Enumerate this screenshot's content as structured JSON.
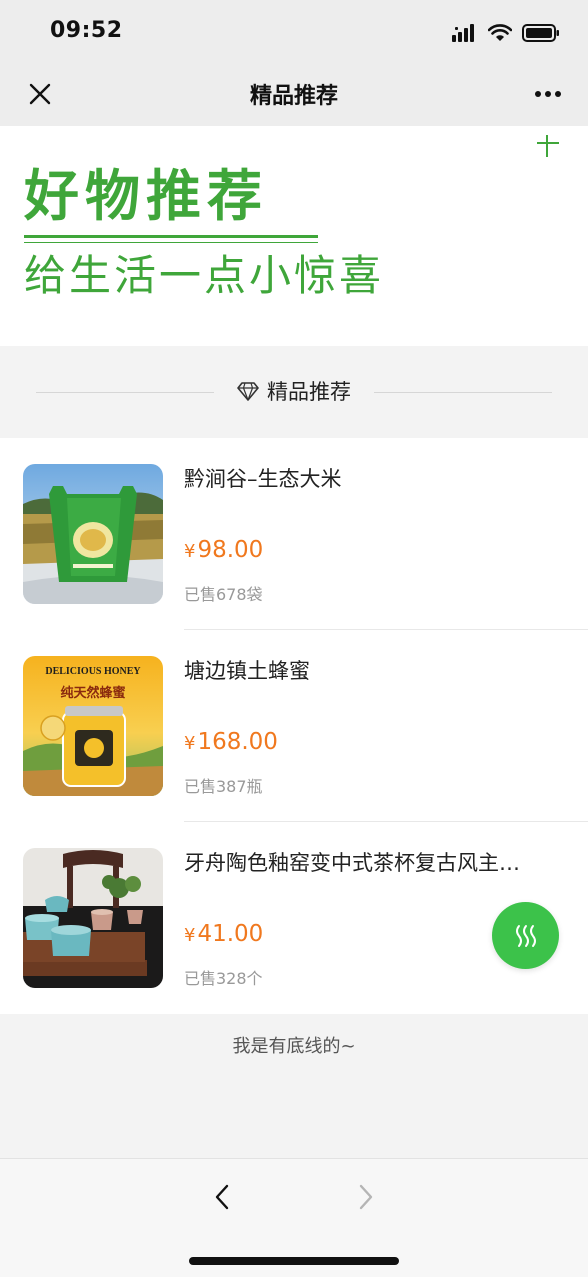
{
  "status_bar": {
    "time": "09:52"
  },
  "nav": {
    "title": "精品推荐"
  },
  "banner": {
    "title": "好物推荐",
    "subtitle": "给生活一点小惊喜",
    "color": "#3fa63a"
  },
  "section": {
    "label": "精品推荐",
    "icon": "diamond-icon"
  },
  "products": [
    {
      "name": "黔涧谷–生态大米",
      "currency": "¥",
      "price": "98.00",
      "sold": "已售678袋"
    },
    {
      "name": "塘边镇土蜂蜜",
      "currency": "¥",
      "price": "168.00",
      "sold": "已售387瓶",
      "image_text_1": "DELICIOUS HONEY",
      "image_text_2": "纯天然蜂蜜"
    },
    {
      "name": "牙舟陶色釉窑变中式茶杯复古风主…",
      "currency": "¥",
      "price": "41.00",
      "sold": "已售328个"
    }
  ],
  "footer": {
    "text": "我是有底线的~"
  },
  "colors": {
    "accent": "#3cc24a",
    "price": "#f0781e",
    "banner_green": "#3fa63a"
  },
  "icons": {
    "close": "close-icon",
    "more": "more-icon",
    "fab": "wave-icon",
    "back": "chevron-left-icon",
    "forward": "chevron-right-icon"
  }
}
